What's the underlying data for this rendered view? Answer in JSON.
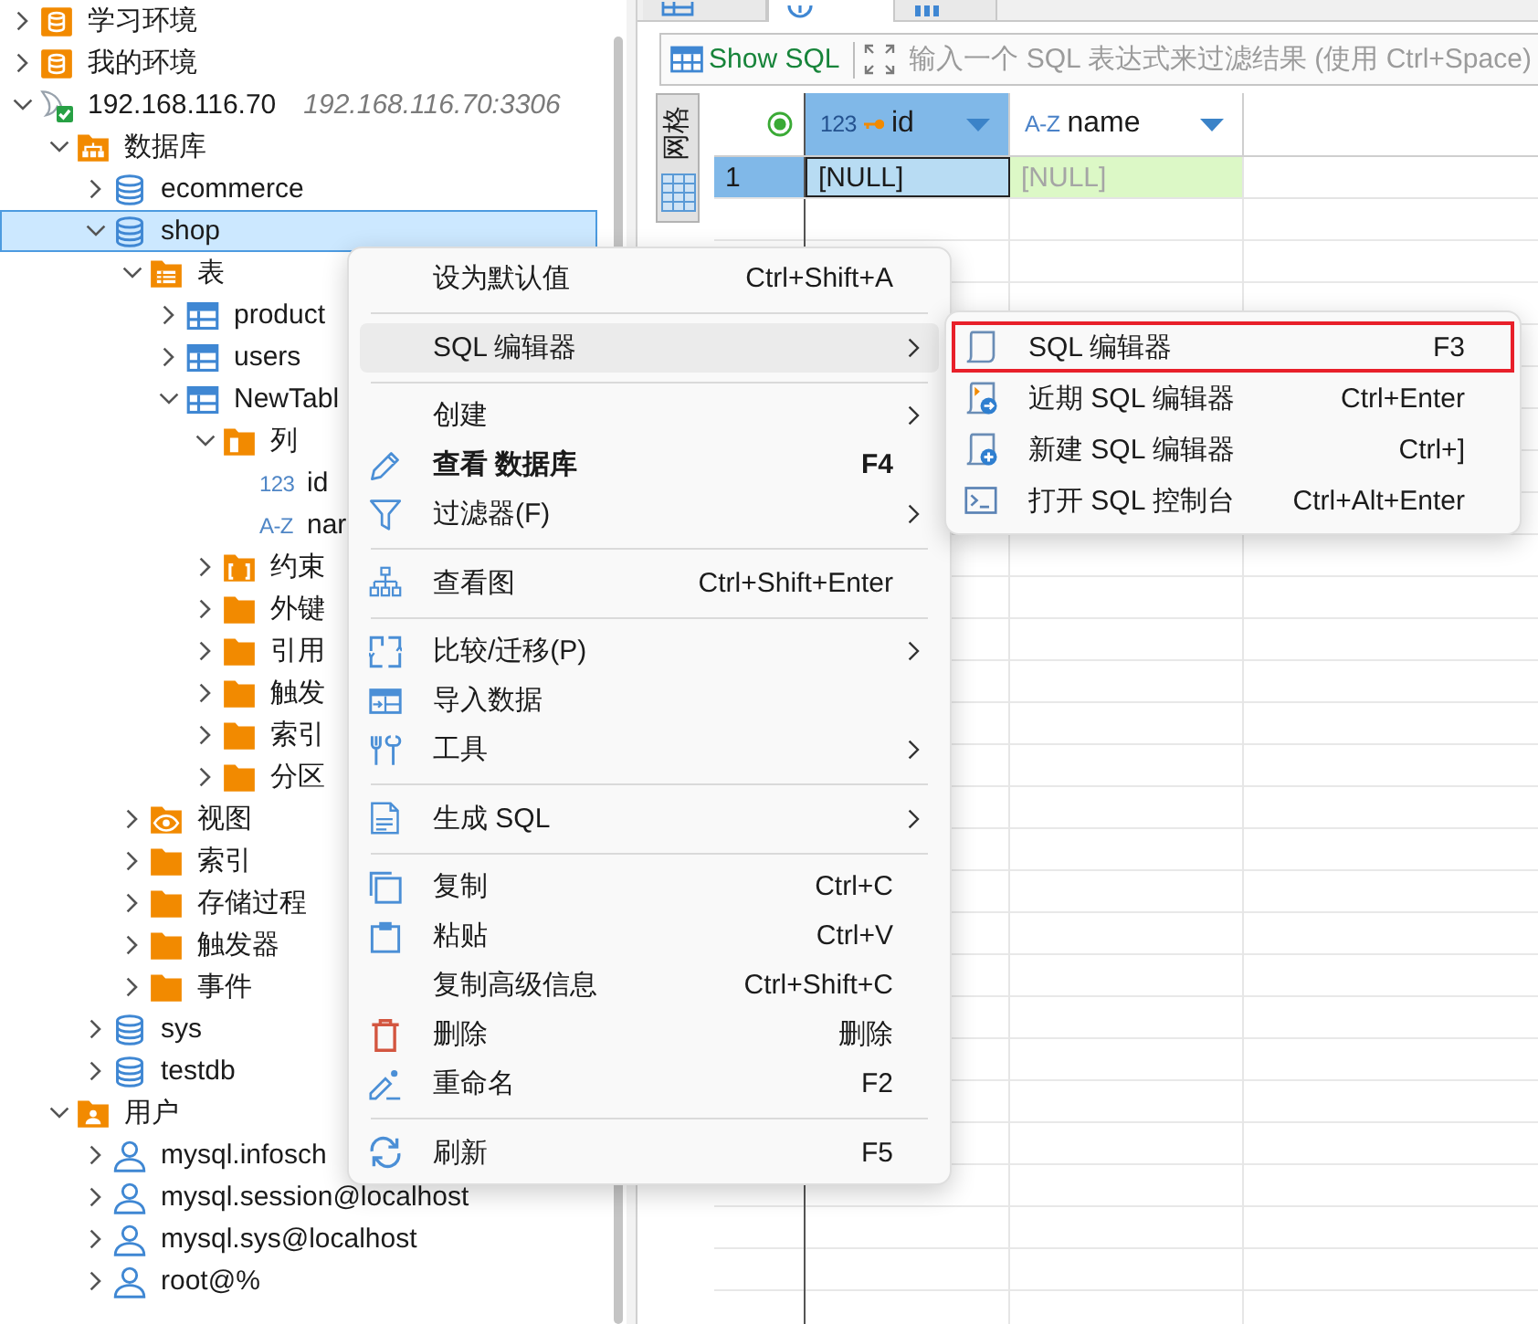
{
  "tree": [
    {
      "kind": "environment",
      "label": "学习环境",
      "expanded": false,
      "selected": false
    },
    {
      "kind": "environment",
      "label": "我的环境",
      "expanded": false,
      "selected": false
    },
    {
      "kind": "connection",
      "label": "192.168.116.70",
      "detail": "192.168.116.70:3306",
      "expanded": true,
      "selected": false,
      "children": [
        {
          "kind": "database-folder",
          "label": "数据库",
          "expanded": true,
          "selected": false,
          "children": [
            {
              "kind": "database",
              "label": "ecommerce",
              "expanded": false,
              "selected": false
            },
            {
              "kind": "database",
              "label": "shop",
              "expanded": true,
              "selected": true,
              "children": [
                {
                  "kind": "table-folder",
                  "label": "表",
                  "expanded": true,
                  "selected": false,
                  "children": [
                    {
                      "kind": "table",
                      "label": "product",
                      "expanded": false,
                      "selected": false
                    },
                    {
                      "kind": "table",
                      "label": "users",
                      "expanded": false,
                      "selected": false
                    },
                    {
                      "kind": "table",
                      "label": "NewTabl",
                      "expanded": true,
                      "selected": false,
                      "children": [
                        {
                          "kind": "column-folder",
                          "label": "列",
                          "expanded": true,
                          "selected": false,
                          "children": [
                            {
                              "kind": "column",
                              "type_label": "123",
                              "label": "id",
                              "selected": false
                            },
                            {
                              "kind": "column",
                              "type_label": "A-Z",
                              "label": "nar",
                              "selected": false
                            }
                          ]
                        },
                        {
                          "kind": "constraint-folder",
                          "label": "约束",
                          "expanded": false,
                          "selected": false
                        },
                        {
                          "kind": "folder",
                          "label": "外键",
                          "expanded": false,
                          "selected": false
                        },
                        {
                          "kind": "folder",
                          "label": "引用",
                          "expanded": false,
                          "selected": false
                        },
                        {
                          "kind": "folder",
                          "label": "触发",
                          "expanded": false,
                          "selected": false
                        },
                        {
                          "kind": "folder",
                          "label": "索引",
                          "expanded": false,
                          "selected": false
                        },
                        {
                          "kind": "folder",
                          "label": "分区",
                          "expanded": false,
                          "selected": false
                        }
                      ]
                    }
                  ]
                },
                {
                  "kind": "view-folder",
                  "label": "视图",
                  "expanded": false,
                  "selected": false
                },
                {
                  "kind": "folder",
                  "label": "索引",
                  "expanded": false,
                  "selected": false
                },
                {
                  "kind": "folder",
                  "label": "存储过程",
                  "expanded": false,
                  "selected": false
                },
                {
                  "kind": "folder",
                  "label": "触发器",
                  "expanded": false,
                  "selected": false
                },
                {
                  "kind": "folder",
                  "label": "事件",
                  "expanded": false,
                  "selected": false
                }
              ]
            },
            {
              "kind": "database",
              "label": "sys",
              "expanded": false,
              "selected": false
            },
            {
              "kind": "database",
              "label": "testdb",
              "expanded": false,
              "selected": false
            }
          ]
        },
        {
          "kind": "user-folder",
          "label": "用户",
          "expanded": true,
          "selected": false,
          "children": [
            {
              "kind": "user",
              "label": "mysql.infosch",
              "expanded": false,
              "selected": false
            },
            {
              "kind": "user",
              "label": "mysql.session@localhost",
              "expanded": false,
              "selected": false
            },
            {
              "kind": "user",
              "label": "mysql.sys@localhost",
              "expanded": false,
              "selected": false
            },
            {
              "kind": "user",
              "label": "root@%",
              "expanded": false,
              "selected": false
            }
          ]
        }
      ]
    }
  ],
  "editor_tabs": [
    {
      "selected": false
    },
    {
      "selected": true
    },
    {
      "selected": false
    }
  ],
  "toolbar": {
    "show_sql": "Show SQL",
    "filter": {
      "placeholder": "输入一个 SQL 表达式来过滤结果 (使用 Ctrl+Space)"
    }
  },
  "view_tab": {
    "label": "网格"
  },
  "grid": {
    "columns": [
      {
        "type_label": "123",
        "name": "id",
        "key": true,
        "selected": true
      },
      {
        "type_label": "A-Z",
        "name": "name",
        "key": false,
        "selected": false
      }
    ],
    "rows": [
      {
        "number": "1",
        "selected": true,
        "inserted": true,
        "cells": [
          {
            "value": "[NULL]",
            "selected": true
          },
          {
            "value": "[NULL]",
            "selected": false
          }
        ]
      }
    ]
  },
  "context_menu": {
    "items": [
      {
        "kind": "plain",
        "label": "设为默认值",
        "shortcut": "Ctrl+Shift+A",
        "has_submenu": false,
        "selected": false,
        "default": false
      },
      {
        "kind": "separator"
      },
      {
        "kind": "plain",
        "label": "SQL 编辑器",
        "has_submenu": true,
        "selected": true,
        "default": false
      },
      {
        "kind": "separator"
      },
      {
        "kind": "plain",
        "label": "创建",
        "has_submenu": true,
        "selected": false,
        "default": false
      },
      {
        "kind": "edit",
        "label": "查看 数据库",
        "shortcut": "F4",
        "has_submenu": false,
        "selected": false,
        "default": true
      },
      {
        "kind": "filter",
        "label": "过滤器(F)",
        "has_submenu": true,
        "selected": false,
        "default": false
      },
      {
        "kind": "separator"
      },
      {
        "kind": "diagram",
        "label": "查看图",
        "shortcut": "Ctrl+Shift+Enter",
        "has_submenu": false,
        "selected": false,
        "default": false
      },
      {
        "kind": "separator"
      },
      {
        "kind": "compare",
        "label": "比较/迁移(P)",
        "has_submenu": true,
        "selected": false,
        "default": false
      },
      {
        "kind": "import",
        "label": "导入数据",
        "has_submenu": false,
        "selected": false,
        "default": false
      },
      {
        "kind": "tools",
        "label": "工具",
        "has_submenu": true,
        "selected": false,
        "default": false
      },
      {
        "kind": "separator"
      },
      {
        "kind": "sql",
        "label": "生成 SQL",
        "has_submenu": true,
        "selected": false,
        "default": false
      },
      {
        "kind": "separator"
      },
      {
        "kind": "copy",
        "label": "复制",
        "shortcut": "Ctrl+C",
        "has_submenu": false,
        "selected": false,
        "default": false
      },
      {
        "kind": "paste",
        "label": "粘贴",
        "shortcut": "Ctrl+V",
        "has_submenu": false,
        "selected": false,
        "default": false
      },
      {
        "kind": "plain",
        "label": "复制高级信息",
        "shortcut": "Ctrl+Shift+C",
        "has_submenu": false,
        "selected": false,
        "default": false
      },
      {
        "kind": "delete",
        "label": "删除",
        "shortcut": "删除",
        "has_submenu": false,
        "selected": false,
        "default": false
      },
      {
        "kind": "rename",
        "label": "重命名",
        "shortcut": "F2",
        "has_submenu": false,
        "selected": false,
        "default": false
      },
      {
        "kind": "separator"
      },
      {
        "kind": "refresh",
        "label": "刷新",
        "shortcut": "F5",
        "has_submenu": false,
        "selected": false,
        "default": false
      }
    ]
  },
  "submenu": {
    "items": [
      {
        "kind": "editor",
        "label": "SQL 编辑器",
        "shortcut": "F3",
        "annotated": true
      },
      {
        "kind": "recent",
        "label": "近期 SQL 编辑器",
        "shortcut": "Ctrl+Enter",
        "annotated": false
      },
      {
        "kind": "new",
        "label": "新建 SQL 编辑器",
        "shortcut": "Ctrl+]",
        "annotated": false
      },
      {
        "kind": "console",
        "label": "打开 SQL 控制台",
        "shortcut": "Ctrl+Alt+Enter",
        "annotated": false
      }
    ]
  }
}
